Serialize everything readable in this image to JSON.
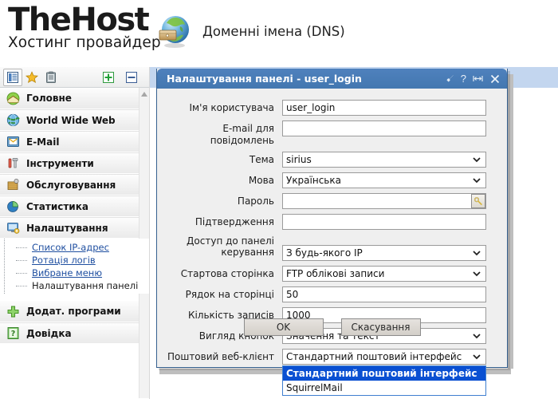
{
  "brand": {
    "logo_main": "TheHost",
    "logo_sub": "Хостинг провайдер",
    "page_title": "Доменні імена (DNS)",
    "globe_icon": "globe-box-icon"
  },
  "sidebar": {
    "toolbar": {
      "icons": [
        {
          "name": "menu-list-icon",
          "glyph": "☰"
        },
        {
          "name": "favorites-star-icon",
          "glyph": "★"
        },
        {
          "name": "clipboard-icon",
          "glyph": "📋"
        }
      ],
      "expand_all": {
        "name": "expand-all-icon",
        "glyph": "+"
      },
      "collapse_all": {
        "name": "collapse-all-icon",
        "glyph": "−"
      }
    },
    "scroll_up_icon": "scroll-up-arrow-icon",
    "groups": [
      {
        "label": "Головне",
        "icon": "home-icon"
      },
      {
        "label": "World Wide Web",
        "icon": "globe-web-icon"
      },
      {
        "label": "E-Mail",
        "icon": "email-icon"
      },
      {
        "label": "Інструменти",
        "icon": "tools-icon"
      },
      {
        "label": "Обслуговування",
        "icon": "service-icon"
      },
      {
        "label": "Статистика",
        "icon": "statistics-pie-icon"
      },
      {
        "label": "Налаштування",
        "icon": "settings-monitor-icon"
      }
    ],
    "settings_children": [
      {
        "label": "Список IP-адрес",
        "link": true
      },
      {
        "label": "Ротація логів",
        "link": true
      },
      {
        "label": "Вибране меню",
        "link": true
      },
      {
        "label": "Налаштування панелі",
        "link": false
      }
    ],
    "groups_bottom": [
      {
        "label": "Додат. програми",
        "icon": "plus-green-icon"
      },
      {
        "label": "Довідка",
        "icon": "help-book-icon"
      }
    ]
  },
  "dialog": {
    "title": "Налаштування панелі - user_login",
    "title_icons": [
      {
        "name": "pin-icon",
        "glyph": "◣"
      },
      {
        "name": "help-icon",
        "glyph": "?"
      },
      {
        "name": "restore-icon",
        "glyph": "↔"
      },
      {
        "name": "close-icon",
        "glyph": "✕"
      }
    ],
    "fields": [
      {
        "label": "Ім'я користувача",
        "type": "text",
        "value": "user_login",
        "name": "username-field"
      },
      {
        "label": "E-mail для повідомлень",
        "type": "text",
        "value": "",
        "name": "notify-email-field"
      },
      {
        "label": "Тема",
        "type": "select",
        "value": "sirius",
        "name": "theme-select"
      },
      {
        "label": "Мова",
        "type": "select",
        "value": "Українська",
        "name": "language-select"
      },
      {
        "label": "Пароль",
        "type": "password",
        "value": "",
        "name": "password-field",
        "button_icon": "generate-key-icon"
      },
      {
        "label": "Підтвердження",
        "type": "text",
        "value": "",
        "name": "password-confirm-field"
      },
      {
        "label": "Доступ до панелі керування",
        "type": "select",
        "value": "З будь-якого IP",
        "name": "panel-access-select",
        "two_line": true
      },
      {
        "label": "Стартова сторінка",
        "type": "select",
        "value": "FTP облікові записи",
        "name": "start-page-select"
      },
      {
        "label": "Рядок на сторінці",
        "type": "text",
        "value": "50",
        "name": "rows-per-page-field"
      },
      {
        "label": "Кількість записів",
        "type": "text",
        "value": "1000",
        "name": "records-count-field"
      },
      {
        "label": "Вигляд кнопок",
        "type": "select",
        "value": "Значення та текст",
        "name": "button-style-select"
      },
      {
        "label": "Поштовий веб-клієнт",
        "type": "select",
        "value": "Стандартний поштовий інтерфейс",
        "name": "webmail-select",
        "open": true
      }
    ],
    "webmail_options": [
      {
        "label": "Стандартний поштовий інтерфейс",
        "selected": true
      },
      {
        "label": "SquirrelMail",
        "selected": false
      }
    ],
    "buttons": [
      {
        "label": "OK",
        "name": "ok-button"
      },
      {
        "label": "Скасування",
        "name": "cancel-button"
      }
    ]
  },
  "colors": {
    "title_blue": "#4f81bd",
    "dialog_border": "#35608f",
    "highlight_blue": "#0a50d2",
    "link_blue": "#1f4fa0",
    "content_strip": "#c3d6ef"
  }
}
